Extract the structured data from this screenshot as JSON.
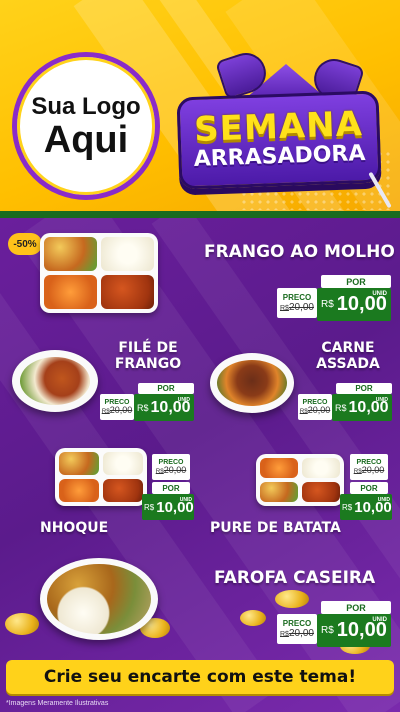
{
  "header": {
    "logo_line1": "Sua Logo",
    "logo_line2": "Aqui",
    "title_line1": "SEMANA",
    "title_line2": "ARRASADORA"
  },
  "discount_badge": "-50%",
  "price_labels": {
    "preco": "PRECO",
    "por": "POR",
    "currency": "R$",
    "unit": "UNID"
  },
  "products": [
    {
      "name": "FRANGO AO MOLHO",
      "old_price": "20,00",
      "new_price": "10,00"
    },
    {
      "name_line1": "FILÉ DE",
      "name_line2": "FRANGO",
      "old_price": "20,00",
      "new_price": "10,00"
    },
    {
      "name_line1": "CARNE",
      "name_line2": "ASSADA",
      "old_price": "20,00",
      "new_price": "10,00"
    },
    {
      "name": "NHOQUE",
      "old_price": "20,00",
      "new_price": "10,00"
    },
    {
      "name": "PURE DE BATATA",
      "old_price": "20,00",
      "new_price": "10,00"
    },
    {
      "name": "FAROFA CASEIRA",
      "old_price": "20,00",
      "new_price": "10,00"
    }
  ],
  "cta": "Crie seu encarte com este tema!",
  "disclaimer": "*Imagens Meramente Ilustrativas",
  "colors": {
    "header_yellow": "#ffc400",
    "purple": "#5b1b8c",
    "price_green": "#1b7a1f",
    "cta_yellow": "#ffd21a"
  }
}
